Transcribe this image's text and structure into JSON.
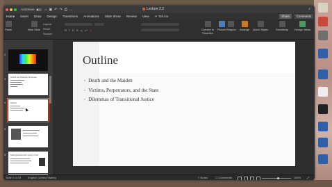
{
  "window": {
    "title": "Lecture 2.2",
    "autosave_label": "AutoSave",
    "autosave_state": "OFF"
  },
  "ribbon": {
    "tabs": [
      "Home",
      "Insert",
      "Draw",
      "Design",
      "Transitions",
      "Animations",
      "Slide Show",
      "Review",
      "View"
    ],
    "active_tab": "Home",
    "tell_me": "Tell me",
    "share_label": "Share",
    "comments_label": "Comments",
    "groups": {
      "paste": "Paste",
      "new_slide": "New Slide",
      "layout": "Layout",
      "reset": "Reset",
      "section": "Section",
      "convert_smartart": "Convert to SmartArt",
      "picture": "Picture",
      "shapes": "Shapes",
      "text_box": "Text Box",
      "arrange": "Arrange",
      "quick_styles": "Quick Styles",
      "sensitivity": "Sensitivity",
      "design_ideas": "Design Ideas"
    }
  },
  "thumbnails": [
    {
      "number": "2",
      "kind": "dark-spectrum"
    },
    {
      "number": "3",
      "title": "Global and Domestic Response"
    },
    {
      "number": "4",
      "title": "Outline",
      "selected": true
    },
    {
      "number": "5",
      "kind": "photo"
    },
    {
      "number": "6",
      "title": "Main Questions & Context of the"
    },
    {
      "number": "7",
      "kind": "photo"
    }
  ],
  "slide": {
    "title": "Outline",
    "bullets": [
      "Death and the Maiden",
      "Victims, Perpetrators, and the State",
      "Dilemmas of Transitional Justice"
    ]
  },
  "status": {
    "slide_counter": "Slide 4 of 15",
    "language": "English (United States)",
    "notes": "Notes",
    "comments": "Comments",
    "zoom": "100%",
    "zoom_level": 0.55
  },
  "colors": {
    "accent": "#e06040",
    "ribbon_bg": "#2f2f2f",
    "slide_bg": "#ffffff"
  }
}
